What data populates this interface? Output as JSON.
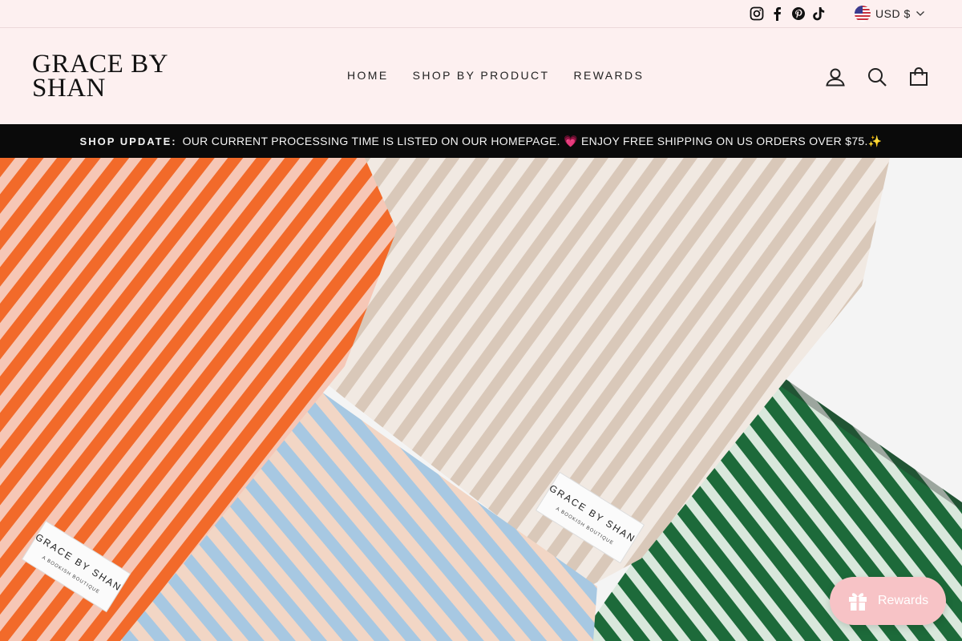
{
  "utility": {
    "socials": [
      "instagram-icon",
      "facebook-icon",
      "pinterest-icon",
      "tiktok-icon"
    ],
    "currency": "USD $"
  },
  "header": {
    "logo_line1": "GRACE BY",
    "logo_line2": "SHAN",
    "nav": [
      "HOME",
      "SHOP BY PRODUCT",
      "REWARDS"
    ],
    "icons": [
      "account-icon",
      "search-icon",
      "cart-icon"
    ]
  },
  "announcement": {
    "label": "SHOP UPDATE:",
    "text": "OUR CURRENT PROCESSING TIME IS LISTED ON OUR HOMEPAGE. 💗 ENJOY FREE SHIPPING ON US ORDERS OVER $75.✨"
  },
  "hero": {
    "label_text": "GRACE BY SHAN",
    "label_subtext": "A BOOKISH BOUTIQUE"
  },
  "rewards_widget": {
    "label": "Rewards"
  },
  "colors": {
    "background": "#fdf0f0",
    "announcement_bg": "#0a0a0a",
    "rewards_bg": "#f7c3c6",
    "orange_stripe": "#f26a2a",
    "beige_stripe": "#d9c8b9",
    "blue_stripe": "#a7c8e2",
    "green_stripe": "#1d6a3a"
  }
}
